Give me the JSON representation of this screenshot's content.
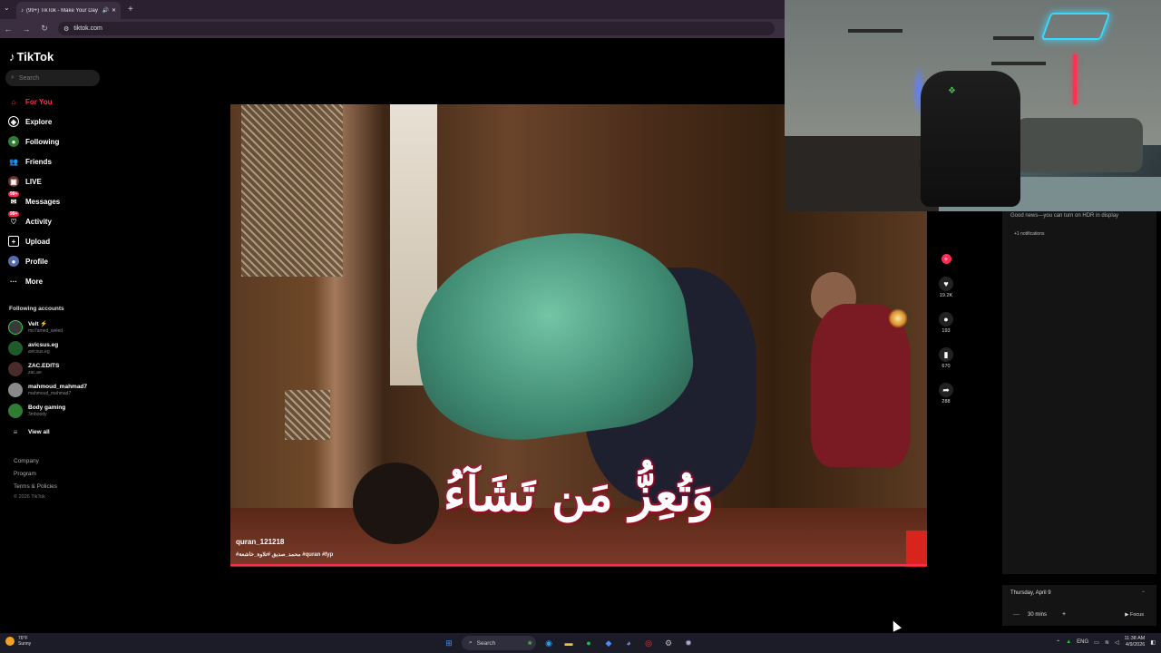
{
  "browser": {
    "tab_title": "(99+) TikTok - Make Your Day",
    "url": "tiktok.com"
  },
  "sidebar": {
    "logo": "TikTok",
    "search_placeholder": "Search",
    "nav": [
      {
        "label": "For You",
        "icon": "home-icon",
        "active": true
      },
      {
        "label": "Explore",
        "icon": "compass-icon"
      },
      {
        "label": "Following",
        "icon": "following-icon"
      },
      {
        "label": "Friends",
        "icon": "friends-icon"
      },
      {
        "label": "LIVE",
        "icon": "live-icon"
      },
      {
        "label": "Messages",
        "icon": "messages-icon",
        "badge": "99+"
      },
      {
        "label": "Activity",
        "icon": "activity-icon",
        "badge": "99+"
      },
      {
        "label": "Upload",
        "icon": "upload-icon"
      },
      {
        "label": "Profile",
        "icon": "profile-icon"
      },
      {
        "label": "More",
        "icon": "more-icon"
      }
    ],
    "following_title": "Following accounts",
    "accounts": [
      {
        "name": "Velt ⚡",
        "handle": "mo7amed_weled"
      },
      {
        "name": "avicsus.eg",
        "handle": "avicsus.eg"
      },
      {
        "name": "ZAC.EDITS",
        "handle": "zac.ae"
      },
      {
        "name": "mahmoud_mahmad7",
        "handle": "mahmoud_mahmad7"
      },
      {
        "name": "Body gaming",
        "handle": "3mboody"
      }
    ],
    "view_all": "View all",
    "footer": {
      "company": "Company",
      "program": "Program",
      "terms": "Terms & Policies",
      "copyright": "© 2026 TikTok"
    }
  },
  "video": {
    "arabic_text": "وَتُعِزُّ مَن تَشَآءُ",
    "username": "quran_121218",
    "caption": "#محمد_صديق #تلاوة_خاشعة #quran #fyp"
  },
  "actions": {
    "likes": "19.2K",
    "comments": "193",
    "saves": "670",
    "shares": "288"
  },
  "notifications": {
    "hdr_text": "Good news—you can turn on HDR in display",
    "more": "+1 notifications"
  },
  "calendar": {
    "date": "Thursday, April 9",
    "minus": "—",
    "duration": "30 mins",
    "plus": "+",
    "focus": "▶ Focus"
  },
  "taskbar": {
    "weather_temp": "76°F",
    "weather_desc": "Sunny",
    "search": "Search",
    "lang": "ENG",
    "time": "11:38 AM",
    "date": "4/9/2026"
  },
  "colors": {
    "accent": "#fe2c55",
    "background": "#000000"
  }
}
